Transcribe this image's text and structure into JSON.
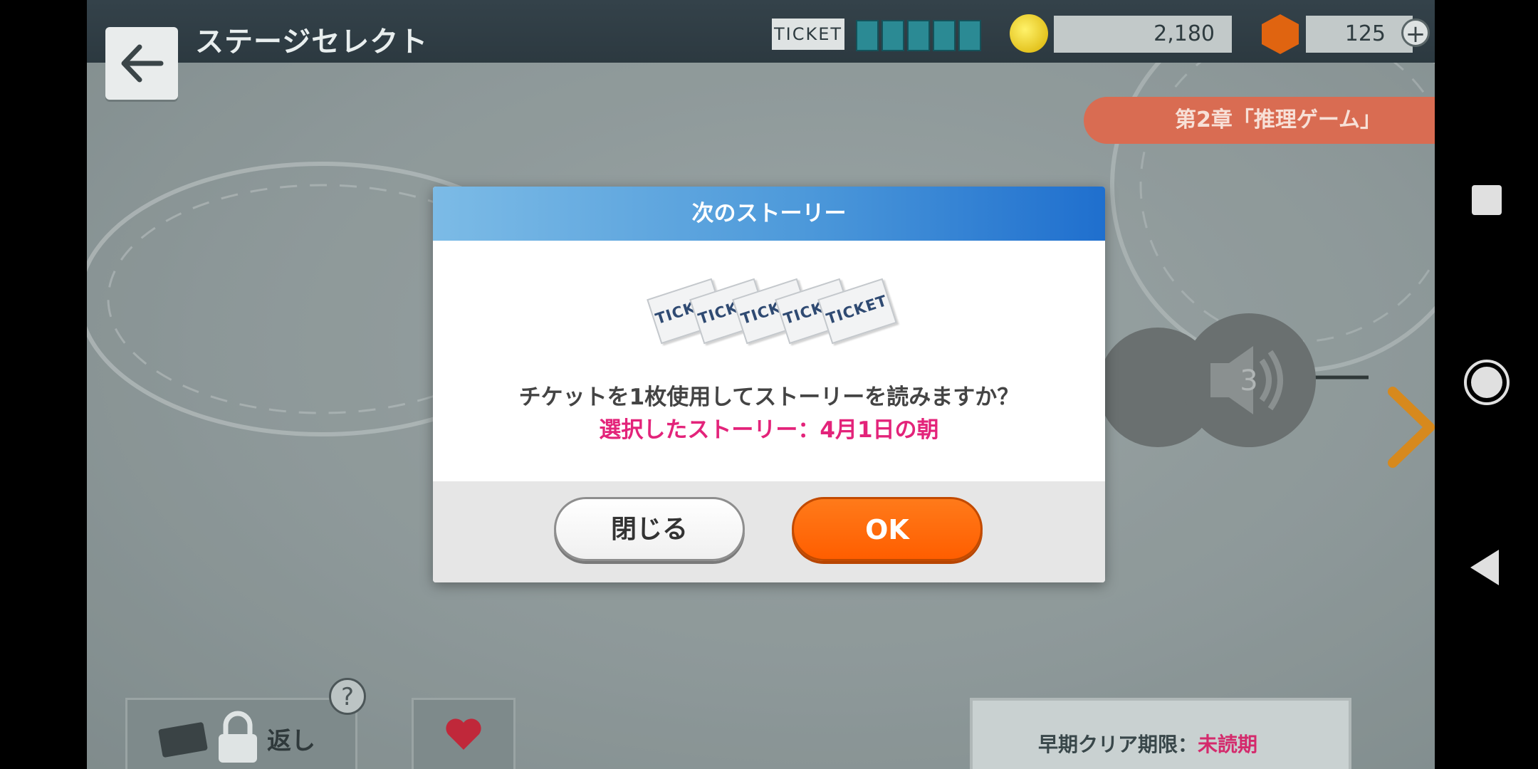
{
  "header": {
    "title": "ステージセレクト",
    "ticket_label": "TICKET",
    "ticket_slots": 5,
    "coins": "2,180",
    "gems": "125",
    "plus": "+"
  },
  "chapter": {
    "label": "第2章「推理ゲーム」"
  },
  "map": {
    "node_number": "3",
    "help_symbol": "?",
    "replay_label": "返し",
    "deadline_label": "早期クリア期限：",
    "deadline_value": "未読期"
  },
  "dialog": {
    "title": "次のストーリー",
    "ticket_text": "TICKET",
    "ticket_count": 5,
    "message": "チケットを1枚使用してストーリーを読みますか？",
    "selected_story": "選択したストーリー：4月1日の朝",
    "close_button": "閉じる",
    "ok_button": "OK"
  },
  "colors": {
    "dialog_header_start": "#7cbbe6",
    "dialog_header_end": "#1f6fce",
    "ok_orange": "#ff6a00",
    "highlight_pink": "#e3237a",
    "chapter_orange": "#d96c52"
  }
}
